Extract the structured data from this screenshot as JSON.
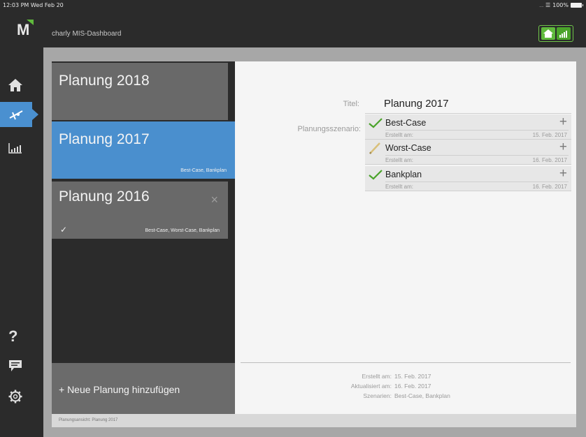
{
  "status": {
    "time": "12:03 PM",
    "date": "Wed Feb 20",
    "battery": "100%"
  },
  "app": {
    "title": "charly MIS-Dashboard",
    "logo_letter": "M",
    "accent": "#4a90d0",
    "green": "#5fb93c"
  },
  "nav": [
    {
      "icon": "home-icon"
    },
    {
      "icon": "planning-icon",
      "active": true
    },
    {
      "icon": "chart-icon"
    },
    {
      "icon": "help-icon",
      "glyph": "?"
    },
    {
      "icon": "comment-icon"
    },
    {
      "icon": "settings-icon"
    }
  ],
  "plans": [
    {
      "name": "Planung 2018",
      "subtitle": ""
    },
    {
      "name": "Planung 2017",
      "subtitle": "Best-Case, Bankplan",
      "active": true
    },
    {
      "name": "Planung 2016",
      "subtitle": "Best-Case, Worst-Case, Bankplan",
      "close": "×",
      "check": "✓"
    }
  ],
  "add_plan": "+ Neue Planung hinzufügen",
  "footer": "Planungsansicht: Planung 2017",
  "detail": {
    "title_label": "Titel:",
    "title_value": "Planung 2017",
    "scenario_label": "Planungsszenario:",
    "scenarios": [
      {
        "name": "Best-Case",
        "created_label": "Erstellt am:",
        "date": "15. Feb. 2017",
        "status": "check"
      },
      {
        "name": "Worst-Case",
        "created_label": "Erstellt am:",
        "date": "16. Feb. 2017",
        "status": "pencil"
      },
      {
        "name": "Bankplan",
        "created_label": "Erstellt am:",
        "date": "16. Feb. 2017",
        "status": "check"
      }
    ],
    "plus": "+",
    "meta": [
      {
        "key": "Erstellt am:",
        "value": "15. Feb. 2017"
      },
      {
        "key": "Aktualisiert am:",
        "value": "16. Feb. 2017"
      },
      {
        "key": "Szenarien:",
        "value": "Best-Case, Bankplan"
      }
    ]
  }
}
